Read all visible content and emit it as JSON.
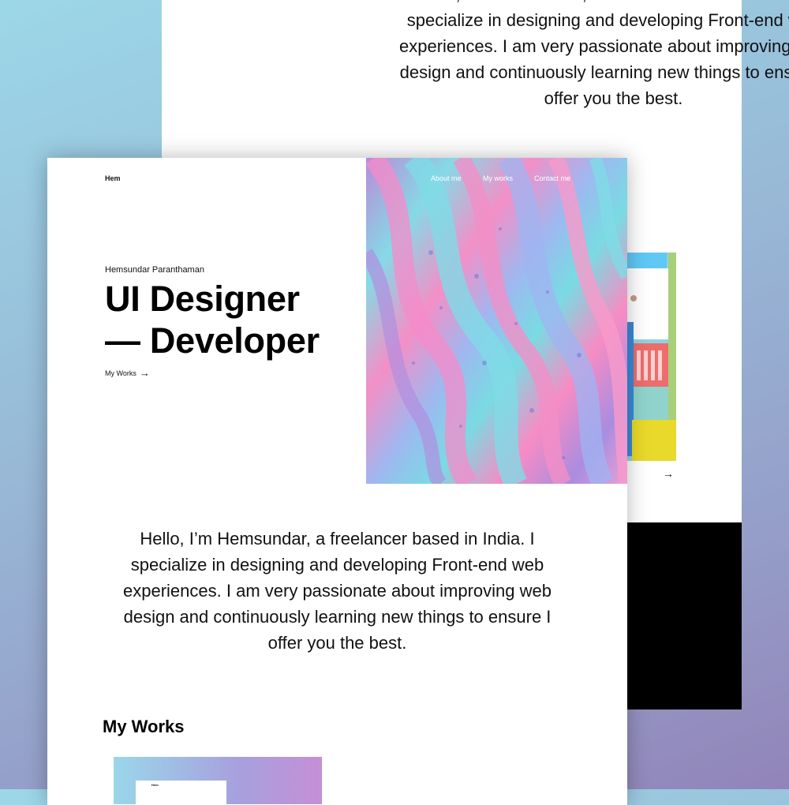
{
  "background_page": {
    "intro": "Hello, I’m Hemsundar, a freelancer based in India. I specialize in designing and developing Front-end web experiences. I am very passionate about improving web design and continuously learning new things to ensure I offer you the best.",
    "arrow_icon": "arrow-right-icon"
  },
  "header": {
    "logo": "Hem",
    "nav": [
      "About me",
      "My works",
      "Contact me"
    ]
  },
  "hero": {
    "name": "Hemsundar Paranthaman",
    "title_line1": "UI Designer",
    "title_line2": "— Developer",
    "cta_label": "My Works",
    "cta_icon": "arrow-right-icon"
  },
  "intro": "Hello, I’m Hemsundar, a freelancer based in India. I specialize in designing and developing Front-end web experiences. I am very passionate about improving web design and continuously learning new things to ensure I offer you the best.",
  "works": {
    "heading": "My Works",
    "thumbnail_label": "Hem"
  },
  "colors": {
    "accent_pink": "#f38fc7",
    "accent_cyan": "#86d9e6",
    "accent_violet": "#a98de0",
    "background_top": "#9cd7e8",
    "background_bottom": "#9284b8"
  }
}
